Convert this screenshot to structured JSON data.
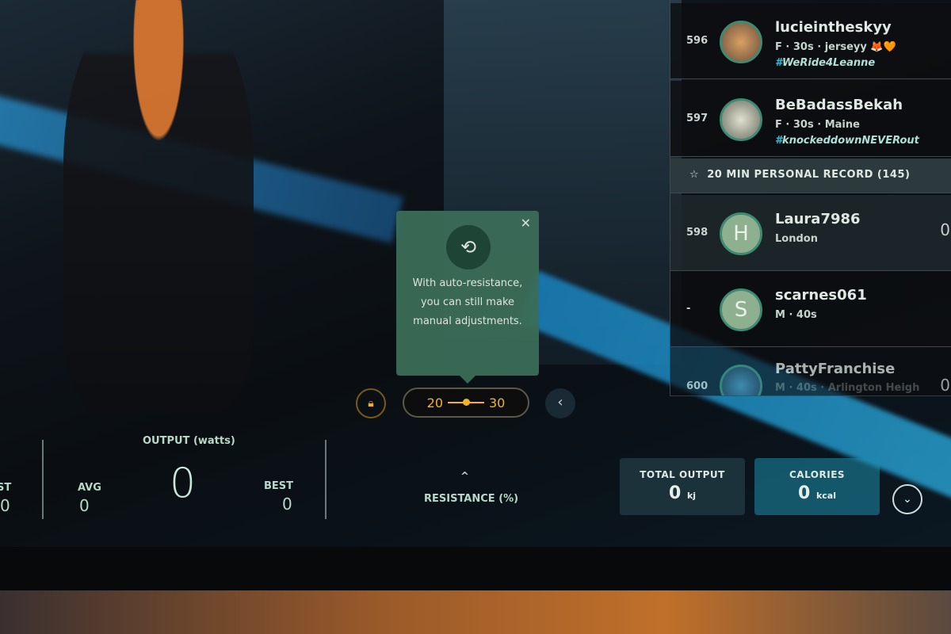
{
  "leaderboard": {
    "rows": [
      {
        "rank": "596",
        "name": "lucieintheskyy",
        "sub": "F · 30s · jerseyy 🦊🧡",
        "tag_hash": "#",
        "tag": "WeRide4Leanne"
      },
      {
        "rank": "597",
        "name": "BeBadassBekah",
        "sub": "F · 30s · Maine",
        "tag_hash": "#",
        "tag": "knockeddownNEVERout"
      },
      {
        "rank": "598",
        "name": "Laura7986",
        "sub": "London",
        "initial": "H",
        "output": "0"
      },
      {
        "rank": "-",
        "name": "scarnes061",
        "sub": "M · 40s",
        "initial": "S"
      },
      {
        "rank": "600",
        "name": "PattyFranchise",
        "sub": "M · 40s · Arlington Heigh",
        "output": "0"
      }
    ],
    "section_icon": "star-icon",
    "section_label": "20 MIN PERSONAL RECORD (145)"
  },
  "tooltip": {
    "icon": "auto-resistance-icon",
    "text": "With auto-resistance, you can still make manual adjustments.",
    "close": "✕"
  },
  "resistance": {
    "lock_icon": "lock-icon",
    "min": "20",
    "max": "30",
    "label": "RESISTANCE (%)",
    "up": "^",
    "back": "‹"
  },
  "output": {
    "title": "OUTPUT (watts)",
    "value": "0",
    "avg_label": "AVG",
    "avg": "0",
    "best_label": "BEST",
    "best": "0",
    "left_label": "ST",
    "left_value": "0"
  },
  "totals": {
    "total_output_label": "TOTAL OUTPUT",
    "total_output": "0",
    "total_output_unit": "kj",
    "calories_label": "CALORIES",
    "calories": "0",
    "calories_unit": "kcal",
    "expand": "⌄"
  },
  "colors": {
    "accent": "#f0b424",
    "tooltip": "#3b6d58",
    "hashtag": "#2ac0d8"
  }
}
